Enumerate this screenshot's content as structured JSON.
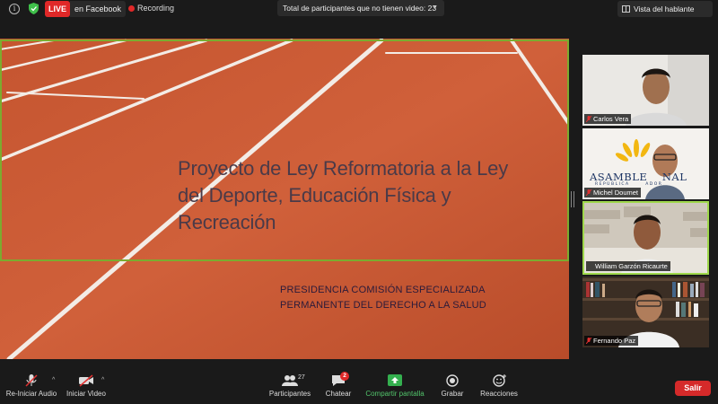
{
  "topbar": {
    "live_label": "LIVE",
    "live_destination": "en Facebook",
    "recording_label": "Recording",
    "participants_dropdown": "Total de participantes que no tienen video: 23",
    "view_label": "Vista del hablante"
  },
  "slide": {
    "title": "Proyecto de Ley Reformatoria a la Ley del Deporte, Educación Física y Recreación",
    "subtitle_line1": "PRESIDENCIA COMISIÓN ESPECIALIZADA",
    "subtitle_line2": "PERMANENTE DEL DERECHO A LA SALUD"
  },
  "participants": [
    {
      "name": "Carlos Vera",
      "active": false
    },
    {
      "name": "Michel Doumet",
      "active": false,
      "background_text": "ASAMBLE    NAL",
      "background_subtext": "REPÚBLICA      ADOR"
    },
    {
      "name": "William  Garzón Ricaurte",
      "active": true
    },
    {
      "name": "Fernando Paz",
      "active": false
    }
  ],
  "toolbar": {
    "reiniciar_audio": "Re-Iniciar Audio",
    "iniciar_video": "Iniciar Video",
    "participantes": "Participantes",
    "participant_count": "27",
    "chatear": "Chatear",
    "chat_badge": "2",
    "compartir": "Compartir pantalla",
    "grabar": "Grabar",
    "reacciones": "Reacciones",
    "salir": "Salir"
  },
  "colors": {
    "live_red": "#e02828",
    "active_border": "#9fd84b",
    "share_green": "#52c46b",
    "leave_red": "#d52a2a",
    "track": "#c85a35",
    "title_frame": "#7cab2f"
  }
}
